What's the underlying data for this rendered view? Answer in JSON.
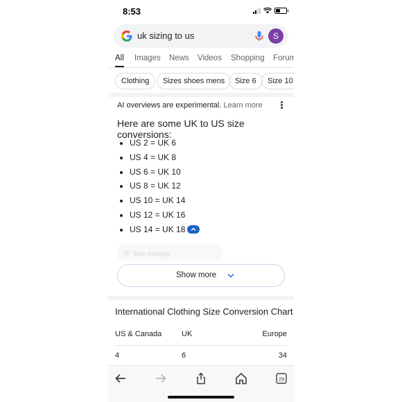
{
  "status_bar": {
    "time": "8:53"
  },
  "search": {
    "query": "uk sizing to us",
    "avatar_letter": "S"
  },
  "tabs": [
    {
      "label": "All",
      "active": true
    },
    {
      "label": "Images"
    },
    {
      "label": "News"
    },
    {
      "label": "Videos"
    },
    {
      "label": "Shopping"
    },
    {
      "label": "Forum"
    }
  ],
  "chips": [
    "Clothing",
    "Sizes shoes mens",
    "Size 6",
    "Size 10"
  ],
  "ai_overview": {
    "notice": "AI overviews are experimental.",
    "learn_more": "Learn more",
    "heading": "Here are some UK to US size conversions:",
    "items": [
      "US 2 = UK 6",
      "US 4 = UK 8",
      "US 6 = UK 10",
      "US 8 = UK 12",
      "US 10 = UK 14",
      "US 12 = UK 16",
      "US 14 = UK 18"
    ],
    "faded_source": "Sika Designs",
    "show_more": "Show more"
  },
  "size_chart": {
    "title": "International Clothing Size Conversion Chart",
    "headers": [
      "US & Canada",
      "UK",
      "Europe"
    ],
    "rows": [
      [
        "4",
        "6",
        "34"
      ]
    ]
  },
  "toolbar": {
    "tab_count": "29"
  },
  "colors": {
    "accent": "#1a62c4",
    "avatar": "#7b3fa7"
  }
}
